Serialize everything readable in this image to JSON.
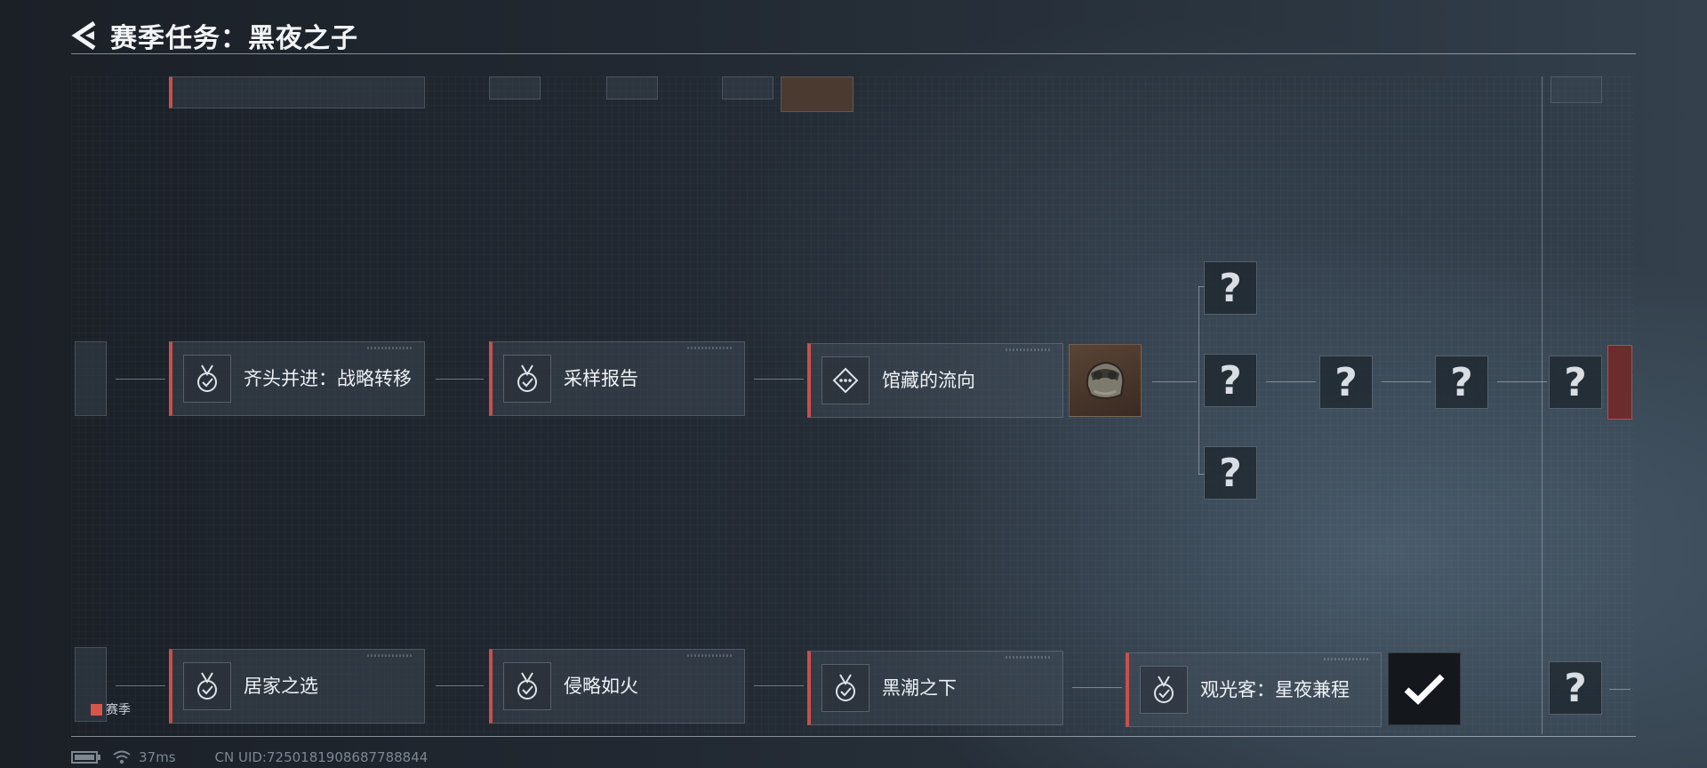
{
  "header": {
    "title": "赛季任务：黑夜之子",
    "back_icon": "back-chevron-icon"
  },
  "quests_middle": [
    {
      "label": "齐头并进：战略转移",
      "icon": "medal-check-icon"
    },
    {
      "label": "采样报告",
      "icon": "medal-check-icon"
    },
    {
      "label": "馆藏的流向",
      "icon": "diamond-dots-icon"
    }
  ],
  "quests_bottom": [
    {
      "label": "居家之选",
      "icon": "medal-check-icon"
    },
    {
      "label": "侵略如火",
      "icon": "medal-check-icon"
    },
    {
      "label": "黑潮之下",
      "icon": "medal-check-icon"
    },
    {
      "label": "观光客：星夜兼程",
      "icon": "medal-check-icon"
    }
  ],
  "mystery_symbol": "?",
  "legend": {
    "label": "赛季",
    "color": "#d8554c"
  },
  "footer": {
    "ping": "37ms",
    "uid": "CN UID:7250181908687788844"
  },
  "colors": {
    "accent": "#c9504a",
    "background": "#222932"
  }
}
